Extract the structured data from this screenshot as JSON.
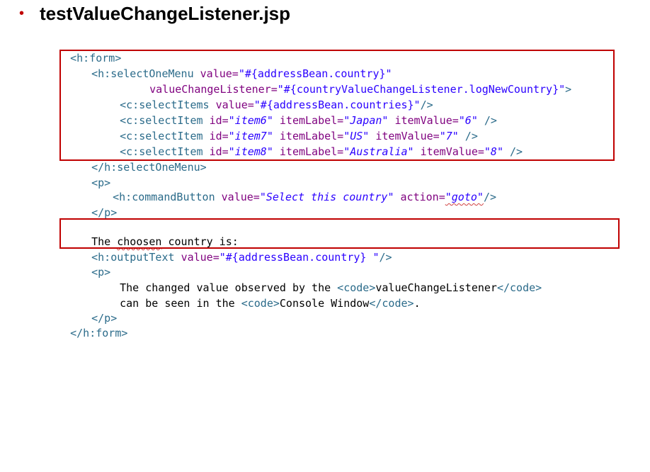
{
  "slide": {
    "bullet": "•",
    "title": "testValueChangeListener.jsp"
  },
  "code": {
    "l1": {
      "tag_open": "<h:form>"
    },
    "l2": {
      "tag": "<h:selectOneMenu ",
      "attr": "value=",
      "val": "\"#{addressBean.country}\""
    },
    "l3": {
      "attr": "valueChangeListener=",
      "val": "\"#{countryValueChangeListener.logNewCountry}\"",
      "tag_end": ">"
    },
    "l4": {
      "tag": "<c:selectItems ",
      "attr": "value=",
      "val": "\"#{addressBean.countries}\"",
      "tag_end": "/>"
    },
    "l5": {
      "tag": "<c:selectItem ",
      "a1": "id=",
      "v1": "\"item6\"",
      "a2": " itemLabel=",
      "v2": "\"Japan\"",
      "a3": " itemValue=",
      "v3": "\"6\"",
      "tag_end": " />"
    },
    "l6": {
      "tag": "<c:selectItem ",
      "a1": "id=",
      "v1": "\"item7\"",
      "a2": " itemLabel=",
      "v2": "\"US\"",
      "a3": " itemValue=",
      "v3": "\"7\"",
      "tag_end": " />"
    },
    "l7": {
      "tag": "<c:selectItem ",
      "a1": "id=",
      "v1": "\"item8\"",
      "a2": " itemLabel=",
      "v2": "\"Australia\"",
      "a3": " itemValue=",
      "v3": "\"8\"",
      "tag_end": " />"
    },
    "l8": {
      "tag": "</h:selectOneMenu>"
    },
    "l9": {
      "tag": "<p>"
    },
    "l10": {
      "tag": "<h:commandButton ",
      "a1": "value=",
      "v1": "\"Select this country\"",
      "a2": " action=",
      "v2": "\"goto\"",
      "tag_end": "/>"
    },
    "l11": {
      "tag": "</p>"
    },
    "l12": {
      "t1": "The ",
      "t2": "choosen",
      "t3": " country is:"
    },
    "l13": {
      "tag": "<h:outputText ",
      "attr": "value=",
      "val": "\"#{addressBean.country} \"",
      "tag_end": "/>"
    },
    "l14": {
      "tag": "<p>"
    },
    "l15": {
      "t1": "The changed value observed by the ",
      "c1": "<code>",
      "t2": "valueChangeListener",
      "c2": "</code>"
    },
    "l16": {
      "t1": "can be seen in the ",
      "c1": "<code>",
      "t2": "Console Window",
      "c2": "</code>",
      "t3": "."
    },
    "l17": {
      "tag": "</p>"
    },
    "l18": {
      "tag": "</h:form>"
    }
  },
  "colors": {
    "highlight_border": "#c00000",
    "tag": "#2b6b8a",
    "attribute": "#7f007f",
    "string": "#2a00ff"
  }
}
